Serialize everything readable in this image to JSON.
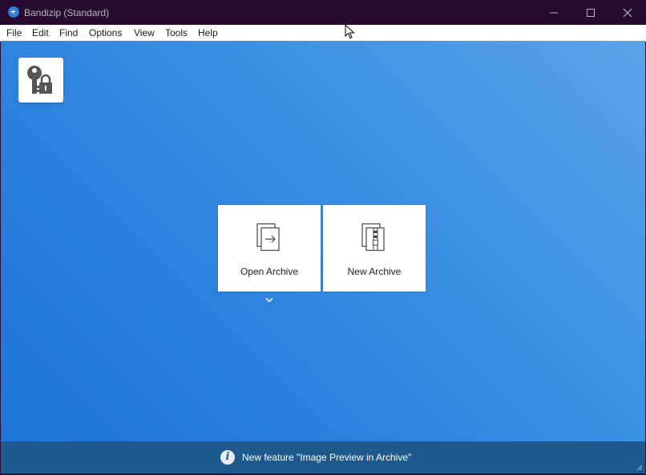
{
  "window": {
    "title": "Bandizip (Standard)",
    "icon": "bandizip-app-icon",
    "controls": [
      "minimize-icon",
      "maximize-icon",
      "close-icon"
    ]
  },
  "menu": {
    "items": [
      "File",
      "Edit",
      "Find",
      "Options",
      "View",
      "Tools",
      "Help"
    ]
  },
  "toolbar": {
    "password_icon": "key-lock-icon"
  },
  "actions": {
    "open_label": "Open Archive",
    "new_label": "New Archive",
    "open_icon": "open-archive-icon",
    "new_icon": "new-archive-icon",
    "dropdown_icon": "chevron-down-icon"
  },
  "status": {
    "icon": "info-icon",
    "text": "New feature \"Image Preview in Archive\""
  },
  "colors": {
    "titlebar": "#28092f",
    "background_gradient": [
      "#5aa3e6",
      "#1f74d8"
    ],
    "statusbar": "#1f5a8f"
  }
}
